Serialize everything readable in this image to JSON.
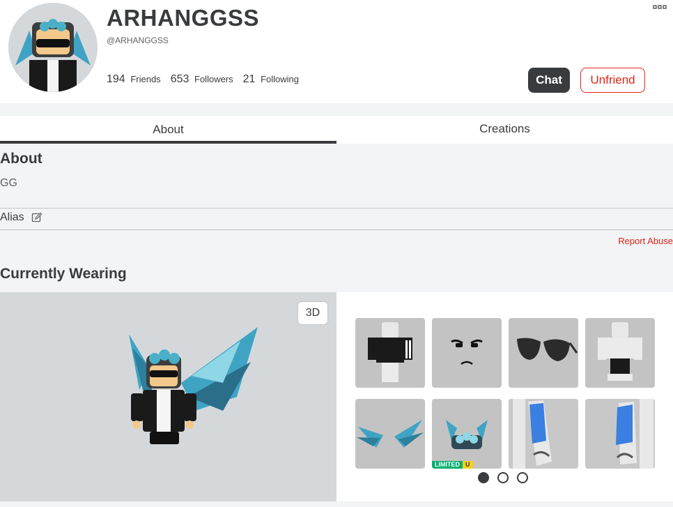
{
  "profile": {
    "display_name": "ARHANGGSS",
    "username": "@ARHANGGSS",
    "stats": [
      {
        "value": "194",
        "label": "Friends"
      },
      {
        "value": "653",
        "label": "Followers"
      },
      {
        "value": "21",
        "label": "Following"
      }
    ],
    "chat_label": "Chat",
    "unfriend_label": "Unfriend"
  },
  "tabs": [
    {
      "label": "About",
      "active": true
    },
    {
      "label": "Creations",
      "active": false
    }
  ],
  "about": {
    "title": "About",
    "text": "GG",
    "alias_label": "Alias",
    "report_label": "Report Abuse"
  },
  "wearing": {
    "title": "Currently Wearing",
    "viewer_button": "3D",
    "items": [
      {
        "name": "shirt-adidas"
      },
      {
        "name": "face"
      },
      {
        "name": "sunglasses"
      },
      {
        "name": "pants"
      },
      {
        "name": "wings"
      },
      {
        "name": "crown",
        "badge_limited": "LIMITED",
        "badge_u": "U"
      },
      {
        "name": "arm-right"
      },
      {
        "name": "arm-left"
      }
    ],
    "pages": 3,
    "current_page": 1
  },
  "colors": {
    "accent_red": "#e2231a",
    "dark": "#393b3d",
    "limited_green": "#00b06f",
    "limited_yellow": "#f8d019"
  }
}
